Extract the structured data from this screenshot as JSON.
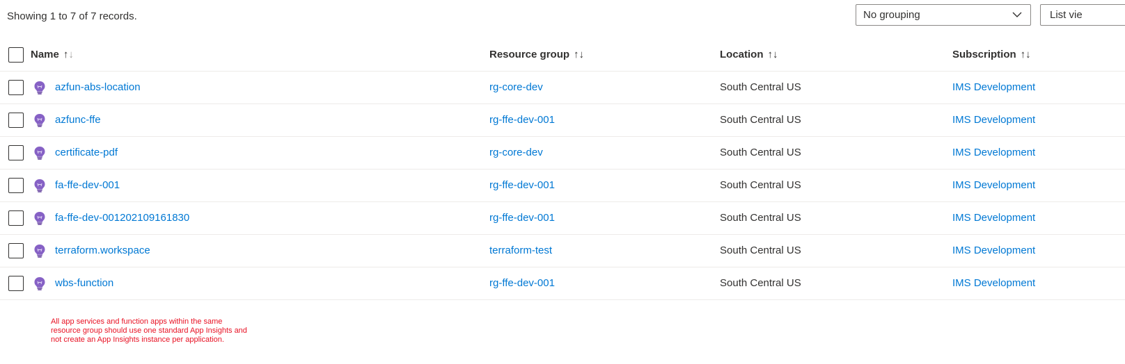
{
  "records_text": "Showing 1 to 7 of 7 records.",
  "grouping": {
    "selected": "No grouping"
  },
  "view": {
    "selected": "List vie"
  },
  "columns": {
    "name": "Name",
    "resource_group": "Resource group",
    "location": "Location",
    "subscription": "Subscription"
  },
  "rows": [
    {
      "name": "azfun-abs-location",
      "resource_group": "rg-core-dev",
      "location": "South Central US",
      "subscription": "IMS Development"
    },
    {
      "name": "azfunc-ffe",
      "resource_group": "rg-ffe-dev-001",
      "location": "South Central US",
      "subscription": "IMS Development"
    },
    {
      "name": "certificate-pdf",
      "resource_group": "rg-core-dev",
      "location": "South Central US",
      "subscription": "IMS Development"
    },
    {
      "name": "fa-ffe-dev-001",
      "resource_group": "rg-ffe-dev-001",
      "location": "South Central US",
      "subscription": "IMS Development"
    },
    {
      "name": "fa-ffe-dev-001202109161830",
      "resource_group": "rg-ffe-dev-001",
      "location": "South Central US",
      "subscription": "IMS Development"
    },
    {
      "name": "terraform.workspace",
      "resource_group": "terraform-test",
      "location": "South Central US",
      "subscription": "IMS Development"
    },
    {
      "name": "wbs-function",
      "resource_group": "rg-ffe-dev-001",
      "location": "South Central US",
      "subscription": "IMS Development"
    }
  ],
  "row_icon": "app-insights-lightbulb-icon",
  "note_lines": [
    "All app services and function apps within the same",
    "resource group should use one standard App Insights and",
    "not create an App Insights instance per application."
  ],
  "colors": {
    "link": "#0078d4",
    "note": "#e81123",
    "icon": "#8661c5"
  }
}
